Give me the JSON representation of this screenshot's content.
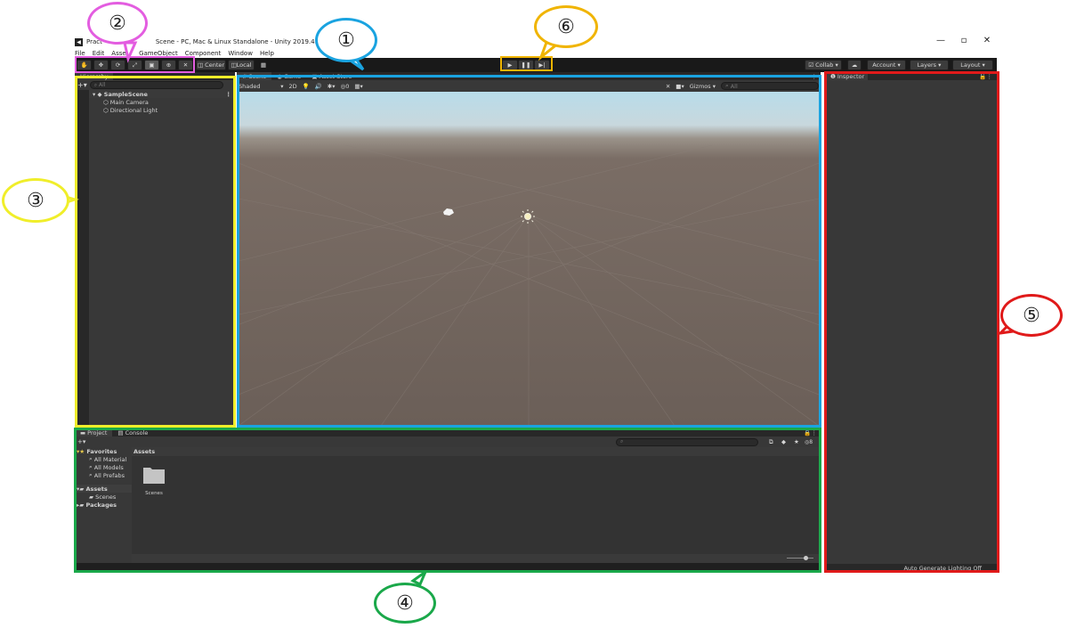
{
  "window": {
    "title": "Practice - SampleScene - PC, Mac & Linux Standalone - Unity 2019.4.24f1 Personal <DX11>",
    "title_visible": "Pract",
    "title_tail": "Scene - PC, Mac & Linux Standalone - Unity 2019.4.24f1 Personal <D",
    "minimize": "—",
    "maximize": "▫",
    "close": "✕"
  },
  "menu": [
    "File",
    "Edit",
    "Assets",
    "GameObject",
    "Component",
    "Window",
    "Help"
  ],
  "toolbar": {
    "pivot": "Center",
    "space": "Local",
    "collab": "Collab",
    "account": "Account",
    "layers": "Layers",
    "layout": "Layout"
  },
  "hierarchy": {
    "tab": "Hierarchy",
    "search_placeholder": "All",
    "scene": "SampleScene",
    "items": [
      "Main Camera",
      "Directional Light"
    ]
  },
  "scene_panel": {
    "tabs": [
      "Scene",
      "Game",
      "Asset Store"
    ],
    "shading": "Shaded",
    "mode_2d": "2D",
    "hidden_count": "0",
    "gizmos": "Gizmos",
    "search_placeholder": "All"
  },
  "project_panel": {
    "tabs": [
      "Project",
      "Console"
    ],
    "favorites_label": "Favorites",
    "favorites": [
      "All Materials",
      "All Models",
      "All Prefabs"
    ],
    "assets_label": "Assets",
    "asset_children": [
      "Scenes"
    ],
    "packages_label": "Packages",
    "breadcrumb": "Assets",
    "folder_items": [
      "Scenes"
    ],
    "hidden_count": "8"
  },
  "inspector": {
    "tab": "Inspector",
    "status": "Auto Generate Lighting Off"
  },
  "callouts": [
    "①",
    "②",
    "③",
    "④",
    "⑤",
    "⑥"
  ],
  "colors": {
    "callout_1": "#1aa3e0",
    "callout_2": "#e35de0",
    "callout_3": "#f0ee2a",
    "callout_4": "#1aa84a",
    "callout_5": "#e01a1a",
    "callout_6": "#f0b400"
  }
}
